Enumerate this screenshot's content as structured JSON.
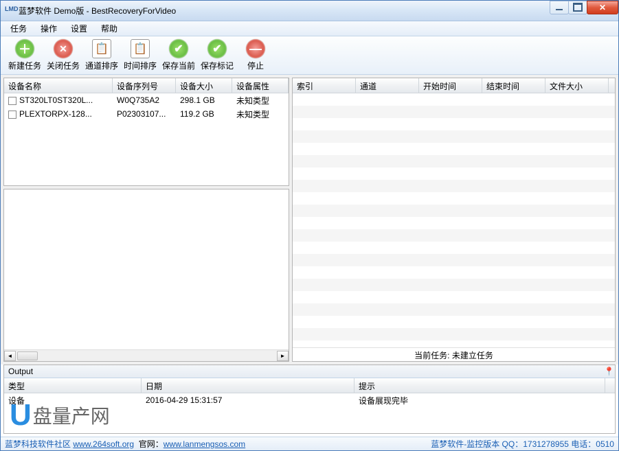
{
  "window": {
    "icon_text": "LMD",
    "title": "蓝梦软件 Demo版 - BestRecoveryForVideo"
  },
  "menu": {
    "items": [
      "任务",
      "操作",
      "设置",
      "帮助"
    ]
  },
  "toolbar": {
    "items": [
      {
        "label": "新建任务",
        "icon": "green",
        "glyph": "＋"
      },
      {
        "label": "关闭任务",
        "icon": "red",
        "glyph": "✕"
      },
      {
        "label": "通道排序",
        "icon": "cal",
        "glyph": "📅"
      },
      {
        "label": "时间排序",
        "icon": "cal",
        "glyph": "📅"
      },
      {
        "label": "保存当前",
        "icon": "green",
        "glyph": "✔"
      },
      {
        "label": "保存标记",
        "icon": "green",
        "glyph": "✔"
      },
      {
        "label": "停止",
        "icon": "red",
        "glyph": "―"
      }
    ]
  },
  "device_table": {
    "headers": [
      "设备名称",
      "设备序列号",
      "设备大小",
      "设备属性"
    ],
    "rows": [
      {
        "name": "ST320LT0ST320L...",
        "serial": "W0Q735A2",
        "size": "298.1 GB",
        "attr": "未知类型"
      },
      {
        "name": "PLEXTORPX-128...",
        "serial": "P02303107...",
        "size": "119.2 GB",
        "attr": "未知类型"
      }
    ]
  },
  "right_table": {
    "headers": [
      "索引",
      "通道",
      "开始时间",
      "结束时间",
      "文件大小"
    ],
    "status_label": "当前任务:",
    "status_value": "未建立任务"
  },
  "output": {
    "title": "Output",
    "headers": [
      "类型",
      "日期",
      "提示"
    ],
    "rows": [
      {
        "type": "设备",
        "date": "2016-04-29 15:31:57",
        "msg": "设备展现完毕"
      }
    ]
  },
  "footer": {
    "left_prefix": "蓝梦科技软件社区",
    "left_link1": "www.264soft.org",
    "mid": "官网：",
    "left_link2": "www.lanmengsos.com",
    "right": "蓝梦软件-监控版本  QQ：1731278955  电话：0510"
  },
  "watermark": {
    "u": "U",
    "text": "盘量产网"
  }
}
